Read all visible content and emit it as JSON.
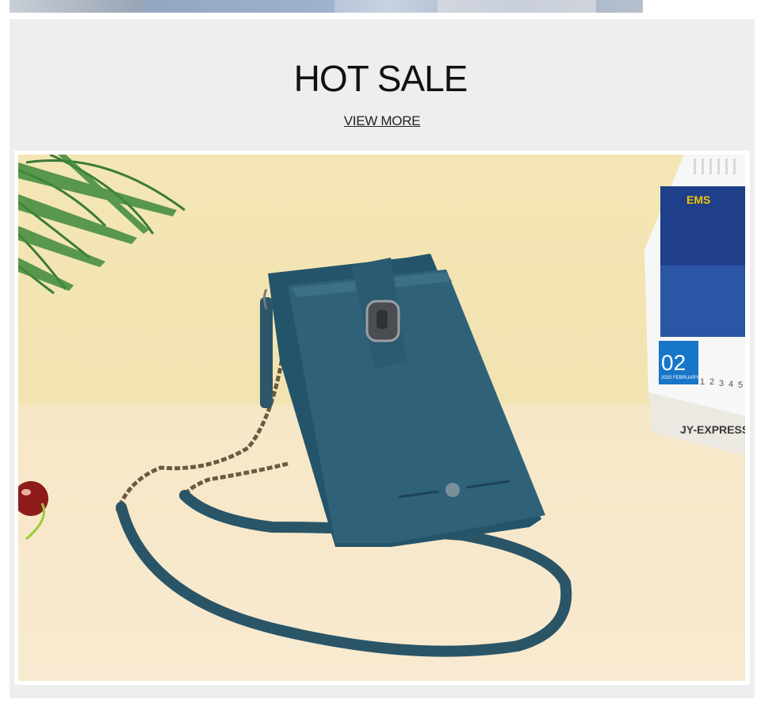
{
  "section": {
    "title": "HOT SALE",
    "view_more_label": "VIEW MORE"
  },
  "product_image": {
    "alt_subject": "blue leather phone crossbody bag with chain strap",
    "calendar": {
      "day": "02",
      "month_label": "2020 FEBRUARY",
      "brand_top": "EMS",
      "brand_bottom": "JY-EXPRESS",
      "dates": [
        "1",
        "2",
        "3",
        "4",
        "5"
      ]
    }
  },
  "colors": {
    "panel_bg": "#eeeeee",
    "bag_blue": "#2f5f74",
    "wall": "#f3e6b4",
    "table": "#f8ead0"
  }
}
